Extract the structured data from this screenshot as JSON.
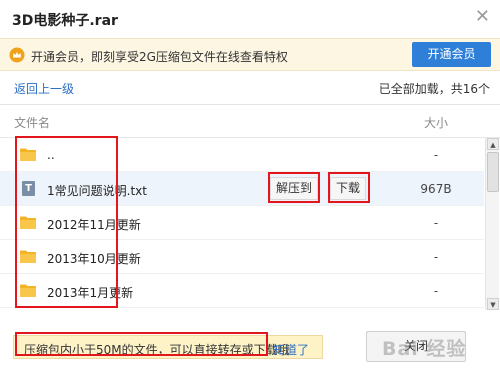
{
  "window": {
    "title": "3D电影种子.rar"
  },
  "vip": {
    "message": "开通会员，即刻享受2G压缩包文件在线查看特权",
    "button_label": "开通会员"
  },
  "nav": {
    "back_label": "返回上一级",
    "loaded_info": "已全部加载，共16个"
  },
  "columns": {
    "name": "文件名",
    "size": "大小"
  },
  "files": [
    {
      "name": "..",
      "type": "folder",
      "size": "-"
    },
    {
      "name": "1常见问题说明.txt",
      "type": "file",
      "size": "967B",
      "extract_label": "解压到",
      "download_label": "下载"
    },
    {
      "name": "2012年11月更新",
      "type": "folder",
      "size": "-"
    },
    {
      "name": "2013年10月更新",
      "type": "folder",
      "size": "-"
    },
    {
      "name": "2013年1月更新",
      "type": "folder",
      "size": "-"
    }
  ],
  "footer": {
    "tip_text": "压缩包内小于50M的文件，可以直接转存或下载哦",
    "tip_link": "知道了",
    "close_label": "关闭",
    "watermark": "Bai 经验"
  },
  "colors": {
    "accent_blue": "#2d7fd8",
    "link_blue": "#2b6fc2",
    "folder_yellow": "#f3b327",
    "annotation_red": "#e2161c",
    "tip_bg": "#fdf3c7"
  },
  "icons": {
    "close": "close-icon",
    "vip": "crown-icon",
    "folder": "folder-icon",
    "file": "text-file-icon"
  }
}
